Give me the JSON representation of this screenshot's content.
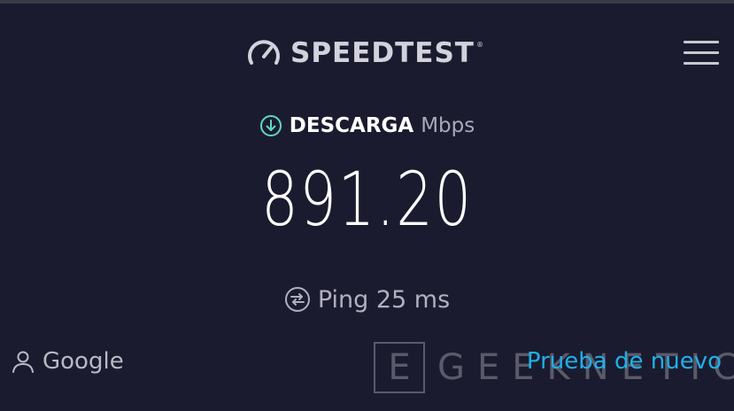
{
  "header": {
    "logo_text": "SPEEDTEST",
    "logo_mark": "®",
    "logo_icon": "gauge-icon",
    "menu_icon": "hamburger-menu-icon"
  },
  "result": {
    "metric_label": "DESCARGA",
    "unit": "Mbps",
    "value": "891.20",
    "download_icon": "download-arrow-icon"
  },
  "ping": {
    "label": "Ping 25 ms",
    "icon": "ping-icon"
  },
  "provider": {
    "name": "Google",
    "icon": "user-icon"
  },
  "actions": {
    "retry_label": "Prueba de nuevo"
  },
  "watermark": {
    "box_letter": "E",
    "text": "GEEKNETIC"
  },
  "colors": {
    "background": "#1b1b2f",
    "accent": "#1fb0e8",
    "download_icon": "#5fd9c0",
    "muted_text": "#b0b0be"
  }
}
